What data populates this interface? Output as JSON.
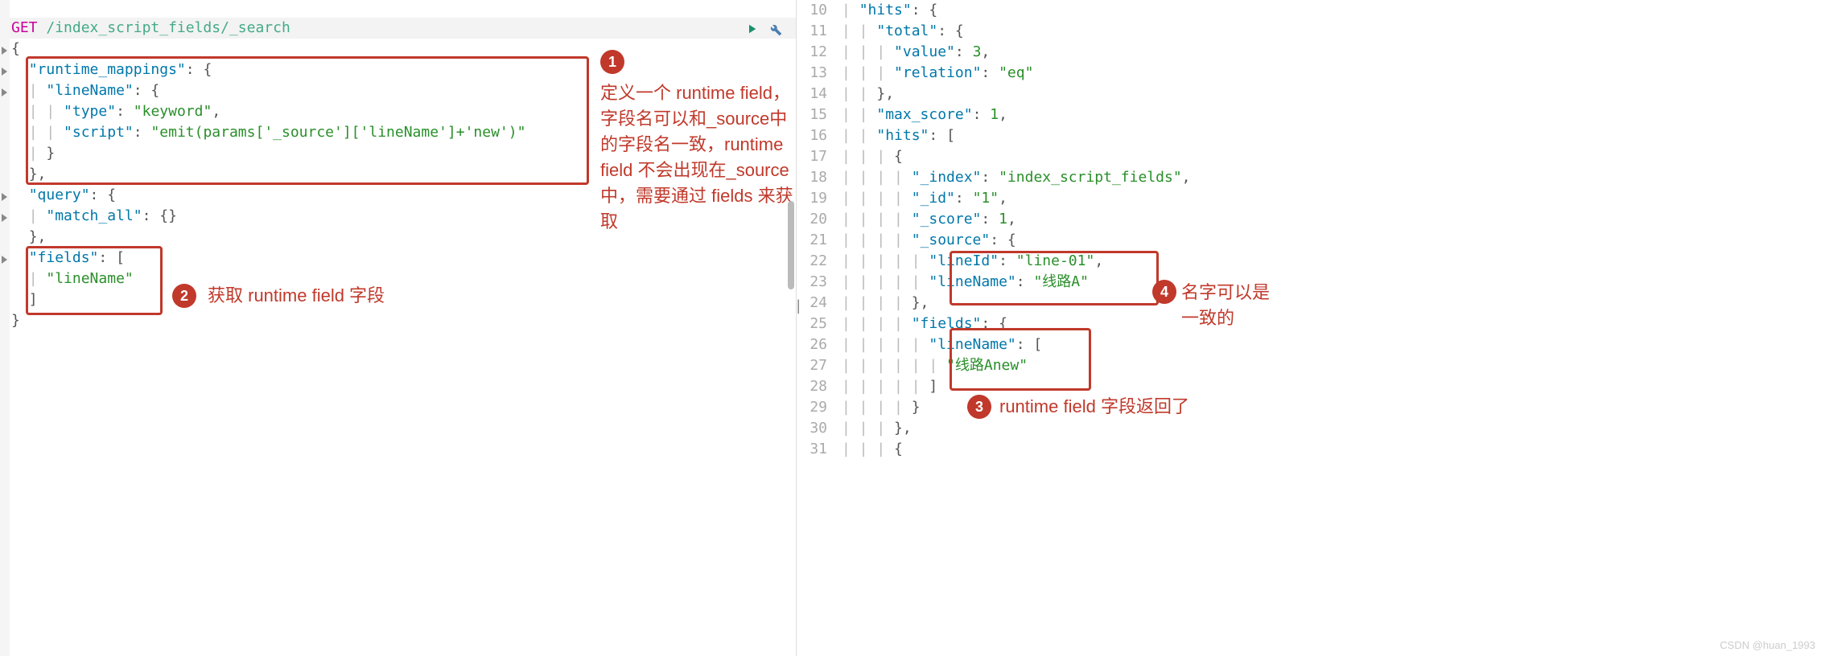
{
  "request": {
    "method": "GET",
    "path": "/index_script_fields/_search",
    "body": {
      "runtime_mappings_key": "\"runtime_mappings\"",
      "lineName_key": "\"lineName\"",
      "type_key": "\"type\"",
      "type_val": "\"keyword\"",
      "script_key": "\"script\"",
      "script_val": "\"emit(params['_source']['lineName']+'new')\"",
      "query_key": "\"query\"",
      "match_all_key": "\"match_all\"",
      "fields_key": "\"fields\"",
      "fields_val0": "\"lineName\""
    }
  },
  "annotations": {
    "a1_badge": "1",
    "a1_text": "定义一个 runtime field，字段名可以和_source中的字段名一致，runtime field 不会出现在_source 中，需要通过 fields 来获取",
    "a2_badge": "2",
    "a2_text": "获取 runtime field 字段",
    "a3_badge": "3",
    "a3_text": "runtime field 字段返回了",
    "a4_badge": "4",
    "a4_text": "名字可以是一致的"
  },
  "response": {
    "lines": [
      {
        "n": "10",
        "parts": [
          {
            "t": "  ",
            "c": "punc"
          },
          {
            "t": "\"hits\"",
            "c": "key"
          },
          {
            "t": ": {",
            "c": "punc"
          }
        ]
      },
      {
        "n": "11",
        "parts": [
          {
            "t": "    ",
            "c": "punc"
          },
          {
            "t": "\"total\"",
            "c": "key"
          },
          {
            "t": ": {",
            "c": "punc"
          }
        ]
      },
      {
        "n": "12",
        "parts": [
          {
            "t": "      ",
            "c": "punc"
          },
          {
            "t": "\"value\"",
            "c": "key"
          },
          {
            "t": ": ",
            "c": "punc"
          },
          {
            "t": "3",
            "c": "num"
          },
          {
            "t": ",",
            "c": "punc"
          }
        ]
      },
      {
        "n": "13",
        "parts": [
          {
            "t": "      ",
            "c": "punc"
          },
          {
            "t": "\"relation\"",
            "c": "key"
          },
          {
            "t": ": ",
            "c": "punc"
          },
          {
            "t": "\"eq\"",
            "c": "string"
          }
        ]
      },
      {
        "n": "14",
        "parts": [
          {
            "t": "    },",
            "c": "punc"
          }
        ]
      },
      {
        "n": "15",
        "parts": [
          {
            "t": "    ",
            "c": "punc"
          },
          {
            "t": "\"max_score\"",
            "c": "key"
          },
          {
            "t": ": ",
            "c": "punc"
          },
          {
            "t": "1",
            "c": "num"
          },
          {
            "t": ",",
            "c": "punc"
          }
        ]
      },
      {
        "n": "16",
        "parts": [
          {
            "t": "    ",
            "c": "punc"
          },
          {
            "t": "\"hits\"",
            "c": "key"
          },
          {
            "t": ": [",
            "c": "punc"
          }
        ]
      },
      {
        "n": "17",
        "parts": [
          {
            "t": "      {",
            "c": "punc"
          }
        ]
      },
      {
        "n": "18",
        "parts": [
          {
            "t": "        ",
            "c": "punc"
          },
          {
            "t": "\"_index\"",
            "c": "key"
          },
          {
            "t": ": ",
            "c": "punc"
          },
          {
            "t": "\"index_script_fields\"",
            "c": "string"
          },
          {
            "t": ",",
            "c": "punc"
          }
        ]
      },
      {
        "n": "19",
        "parts": [
          {
            "t": "        ",
            "c": "punc"
          },
          {
            "t": "\"_id\"",
            "c": "key"
          },
          {
            "t": ": ",
            "c": "punc"
          },
          {
            "t": "\"1\"",
            "c": "string"
          },
          {
            "t": ",",
            "c": "punc"
          }
        ]
      },
      {
        "n": "20",
        "parts": [
          {
            "t": "        ",
            "c": "punc"
          },
          {
            "t": "\"_score\"",
            "c": "key"
          },
          {
            "t": ": ",
            "c": "punc"
          },
          {
            "t": "1",
            "c": "num"
          },
          {
            "t": ",",
            "c": "punc"
          }
        ]
      },
      {
        "n": "21",
        "parts": [
          {
            "t": "        ",
            "c": "punc"
          },
          {
            "t": "\"_source\"",
            "c": "key"
          },
          {
            "t": ": {",
            "c": "punc"
          }
        ]
      },
      {
        "n": "22",
        "parts": [
          {
            "t": "          ",
            "c": "punc"
          },
          {
            "t": "\"lineId\"",
            "c": "key"
          },
          {
            "t": ": ",
            "c": "punc"
          },
          {
            "t": "\"line-01\"",
            "c": "string"
          },
          {
            "t": ",",
            "c": "punc"
          }
        ]
      },
      {
        "n": "23",
        "parts": [
          {
            "t": "          ",
            "c": "punc"
          },
          {
            "t": "\"lineName\"",
            "c": "key"
          },
          {
            "t": ": ",
            "c": "punc"
          },
          {
            "t": "\"线路A\"",
            "c": "string"
          }
        ]
      },
      {
        "n": "24",
        "parts": [
          {
            "t": "        },",
            "c": "punc"
          }
        ]
      },
      {
        "n": "25",
        "parts": [
          {
            "t": "        ",
            "c": "punc"
          },
          {
            "t": "\"fields\"",
            "c": "key"
          },
          {
            "t": ": {",
            "c": "punc"
          }
        ]
      },
      {
        "n": "26",
        "parts": [
          {
            "t": "          ",
            "c": "punc"
          },
          {
            "t": "\"lineName\"",
            "c": "key"
          },
          {
            "t": ": [",
            "c": "punc"
          }
        ]
      },
      {
        "n": "27",
        "parts": [
          {
            "t": "            ",
            "c": "punc"
          },
          {
            "t": "\"线路Anew\"",
            "c": "string"
          }
        ]
      },
      {
        "n": "28",
        "parts": [
          {
            "t": "          ]",
            "c": "punc"
          }
        ]
      },
      {
        "n": "29",
        "parts": [
          {
            "t": "        }",
            "c": "punc"
          }
        ]
      },
      {
        "n": "30",
        "parts": [
          {
            "t": "      },",
            "c": "punc"
          }
        ]
      },
      {
        "n": "31",
        "parts": [
          {
            "t": "      {",
            "c": "punc"
          }
        ]
      }
    ]
  },
  "watermark": "CSDN @huan_1993"
}
